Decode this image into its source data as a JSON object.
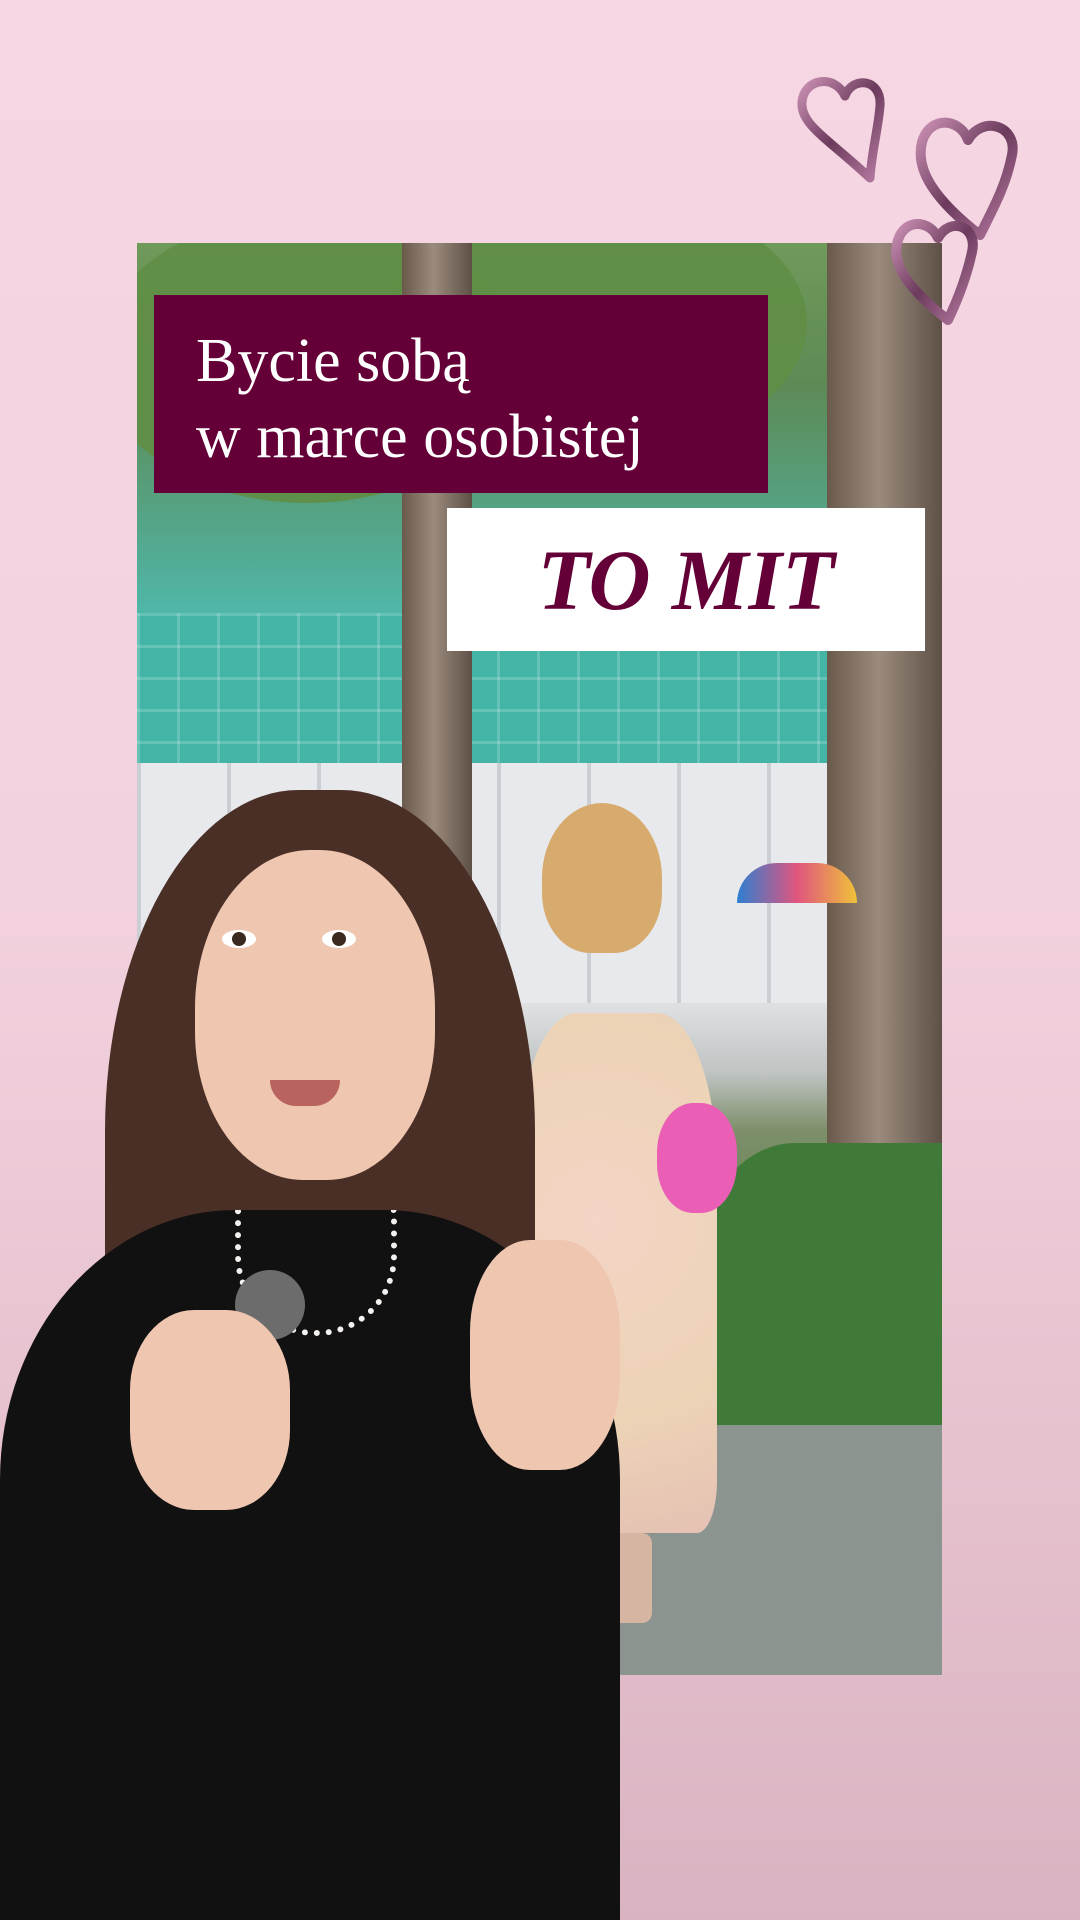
{
  "overlay": {
    "title_line1": "Bycie sobą",
    "title_line2": "w marce osobistej",
    "highlight": "TO MIT"
  },
  "colors": {
    "accent": "#640037",
    "background": "#f6d6e2",
    "highlight_bg": "#ffffff"
  },
  "icons": {
    "decoration": "hearts-icon"
  }
}
